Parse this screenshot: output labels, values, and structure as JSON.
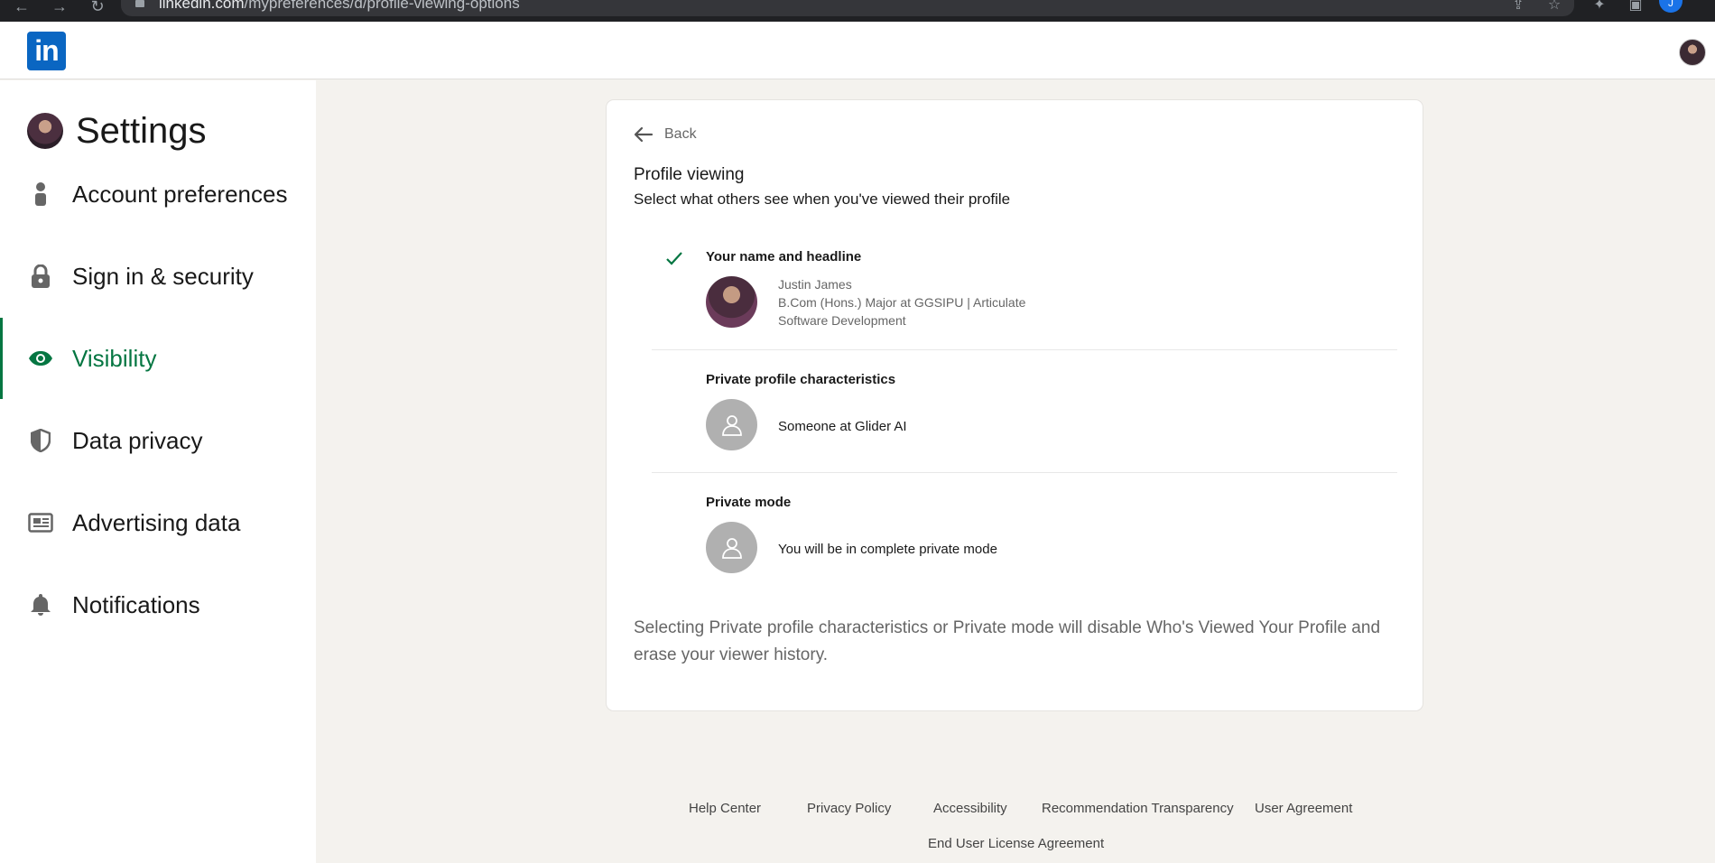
{
  "browser": {
    "url_host": "linkedin.com",
    "url_path": "/mypreferences/d/profile-viewing-options",
    "profile_initial": "J"
  },
  "topbar": {
    "logo": "in"
  },
  "sidebar": {
    "title": "Settings",
    "items": [
      {
        "label": "Account preferences",
        "icon": "person-icon",
        "active": false
      },
      {
        "label": "Sign in & security",
        "icon": "lock-icon",
        "active": false
      },
      {
        "label": "Visibility",
        "icon": "eye-icon",
        "active": true
      },
      {
        "label": "Data privacy",
        "icon": "shield-icon",
        "active": false
      },
      {
        "label": "Advertising data",
        "icon": "newspaper-icon",
        "active": false
      },
      {
        "label": "Notifications",
        "icon": "bell-icon",
        "active": false
      }
    ]
  },
  "card": {
    "back_label": "Back",
    "title": "Profile viewing",
    "subtitle": "Select what others see when you've viewed their profile",
    "options": [
      {
        "label": "Your name and headline",
        "selected": true,
        "name": "Justin James",
        "headline_line1": "B.Com (Hons.) Major at GGSIPU | Articulate",
        "headline_line2": "Software Development"
      },
      {
        "label": "Private profile characteristics",
        "selected": false,
        "text": "Someone at Glider AI"
      },
      {
        "label": "Private mode",
        "selected": false,
        "text": "You will be in complete private mode"
      }
    ],
    "note": "Selecting Private profile characteristics or Private mode will disable Who's Viewed Your Profile and erase your viewer history."
  },
  "footer": {
    "links": [
      "Help Center",
      "Privacy Policy",
      "Accessibility",
      "Recommendation Transparency",
      "User Agreement"
    ],
    "eula": "End User License Agreement"
  },
  "colors": {
    "brand": "#0a66c2",
    "active_green": "#057642",
    "page_bg": "#f4f2ee"
  }
}
